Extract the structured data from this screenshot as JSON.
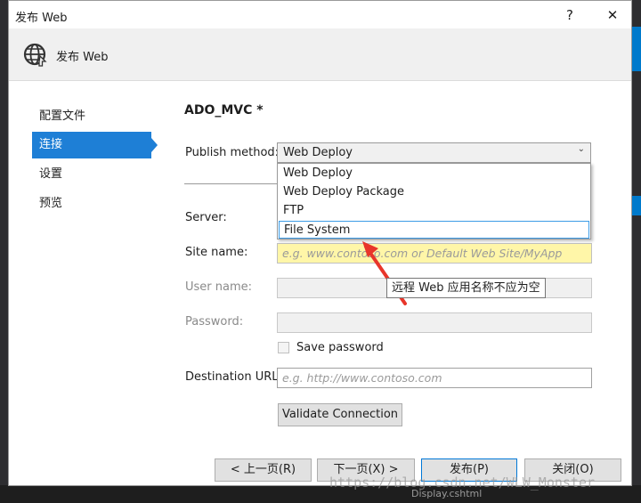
{
  "window": {
    "title": "发布 Web"
  },
  "header": {
    "title": "发布 Web",
    "icon": "globe-publish-icon"
  },
  "sidebar": {
    "items": [
      {
        "label": "配置文件",
        "active": false
      },
      {
        "label": "连接",
        "active": true
      },
      {
        "label": "设置",
        "active": false
      },
      {
        "label": "预览",
        "active": false
      }
    ]
  },
  "profile": {
    "title": "ADO_MVC *"
  },
  "form": {
    "publish_method": {
      "label": "Publish method:",
      "value": "Web Deploy",
      "options": [
        "Web Deploy",
        "Web Deploy Package",
        "FTP",
        "File System"
      ],
      "highlighted": "File System"
    },
    "server": {
      "label": "Server:"
    },
    "site_name": {
      "label": "Site name:",
      "placeholder": "e.g. www.contoso.com or Default Web Site/MyApp",
      "tooltip": "远程 Web 应用名称不应为空"
    },
    "user_name": {
      "label": "User name:"
    },
    "password": {
      "label": "Password:"
    },
    "save_password": {
      "label": "Save password",
      "checked": false
    },
    "destination_url": {
      "label": "Destination URL:",
      "placeholder": "e.g. http://www.contoso.com"
    },
    "validate": {
      "label": "Validate Connection"
    }
  },
  "buttons": {
    "prev": "< 上一页(R)",
    "next": "下一页(X) >",
    "publish": "发布(P)",
    "close": "关闭(O)"
  },
  "titlebar": {
    "help": "?",
    "close": "✕"
  },
  "background": {
    "file_tab": "Display.cshtml",
    "watermark": "https://blog.csdn.net/WLW_Monster"
  },
  "colors": {
    "accent": "#1e7fd6",
    "error_field": "#fff6a8",
    "annotation_arrow": "#e8352a"
  }
}
